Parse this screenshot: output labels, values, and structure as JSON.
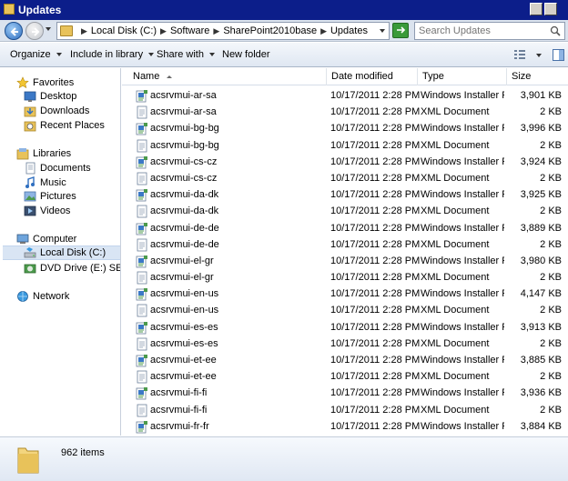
{
  "window": {
    "title": "Updates"
  },
  "address": {
    "crumbs": [
      "Local Disk (C:)",
      "Software",
      "SharePoint2010base",
      "Updates"
    ],
    "search_placeholder": "Search Updates"
  },
  "toolbar": {
    "organize": "Organize",
    "include": "Include in library",
    "share": "Share with",
    "new_folder": "New folder"
  },
  "nav": {
    "favorites": "Favorites",
    "desktop": "Desktop",
    "downloads": "Downloads",
    "recent": "Recent Places",
    "libraries": "Libraries",
    "documents": "Documents",
    "music": "Music",
    "pictures": "Pictures",
    "videos": "Videos",
    "computer": "Computer",
    "local_disk": "Local Disk (C:)",
    "dvd": "DVD Drive (E:) SERVEF",
    "network": "Network"
  },
  "columns": {
    "name": "Name",
    "date": "Date modified",
    "type": "Type",
    "size": "Size"
  },
  "files": [
    {
      "name": "acsrvmui-ar-sa",
      "date": "10/17/2011 2:28 PM",
      "type": "Windows Installer P...",
      "size": "3,901 KB",
      "icon": "msi-installer-icon"
    },
    {
      "name": "acsrvmui-ar-sa",
      "date": "10/17/2011 2:28 PM",
      "type": "XML Document",
      "size": "2 KB",
      "icon": "xml-document-icon"
    },
    {
      "name": "acsrvmui-bg-bg",
      "date": "10/17/2011 2:28 PM",
      "type": "Windows Installer P...",
      "size": "3,996 KB",
      "icon": "msi-installer-icon"
    },
    {
      "name": "acsrvmui-bg-bg",
      "date": "10/17/2011 2:28 PM",
      "type": "XML Document",
      "size": "2 KB",
      "icon": "xml-document-icon"
    },
    {
      "name": "acsrvmui-cs-cz",
      "date": "10/17/2011 2:28 PM",
      "type": "Windows Installer P...",
      "size": "3,924 KB",
      "icon": "msi-installer-icon"
    },
    {
      "name": "acsrvmui-cs-cz",
      "date": "10/17/2011 2:28 PM",
      "type": "XML Document",
      "size": "2 KB",
      "icon": "xml-document-icon"
    },
    {
      "name": "acsrvmui-da-dk",
      "date": "10/17/2011 2:28 PM",
      "type": "Windows Installer P...",
      "size": "3,925 KB",
      "icon": "msi-installer-icon"
    },
    {
      "name": "acsrvmui-da-dk",
      "date": "10/17/2011 2:28 PM",
      "type": "XML Document",
      "size": "2 KB",
      "icon": "xml-document-icon"
    },
    {
      "name": "acsrvmui-de-de",
      "date": "10/17/2011 2:28 PM",
      "type": "Windows Installer P...",
      "size": "3,889 KB",
      "icon": "msi-installer-icon"
    },
    {
      "name": "acsrvmui-de-de",
      "date": "10/17/2011 2:28 PM",
      "type": "XML Document",
      "size": "2 KB",
      "icon": "xml-document-icon"
    },
    {
      "name": "acsrvmui-el-gr",
      "date": "10/17/2011 2:28 PM",
      "type": "Windows Installer P...",
      "size": "3,980 KB",
      "icon": "msi-installer-icon"
    },
    {
      "name": "acsrvmui-el-gr",
      "date": "10/17/2011 2:28 PM",
      "type": "XML Document",
      "size": "2 KB",
      "icon": "xml-document-icon"
    },
    {
      "name": "acsrvmui-en-us",
      "date": "10/17/2011 2:28 PM",
      "type": "Windows Installer P...",
      "size": "4,147 KB",
      "icon": "msi-installer-icon"
    },
    {
      "name": "acsrvmui-en-us",
      "date": "10/17/2011 2:28 PM",
      "type": "XML Document",
      "size": "2 KB",
      "icon": "xml-document-icon"
    },
    {
      "name": "acsrvmui-es-es",
      "date": "10/17/2011 2:28 PM",
      "type": "Windows Installer P...",
      "size": "3,913 KB",
      "icon": "msi-installer-icon"
    },
    {
      "name": "acsrvmui-es-es",
      "date": "10/17/2011 2:28 PM",
      "type": "XML Document",
      "size": "2 KB",
      "icon": "xml-document-icon"
    },
    {
      "name": "acsrvmui-et-ee",
      "date": "10/17/2011 2:28 PM",
      "type": "Windows Installer P...",
      "size": "3,885 KB",
      "icon": "msi-installer-icon"
    },
    {
      "name": "acsrvmui-et-ee",
      "date": "10/17/2011 2:28 PM",
      "type": "XML Document",
      "size": "2 KB",
      "icon": "xml-document-icon"
    },
    {
      "name": "acsrvmui-fi-fi",
      "date": "10/17/2011 2:28 PM",
      "type": "Windows Installer P...",
      "size": "3,936 KB",
      "icon": "msi-installer-icon"
    },
    {
      "name": "acsrvmui-fi-fi",
      "date": "10/17/2011 2:28 PM",
      "type": "XML Document",
      "size": "2 KB",
      "icon": "xml-document-icon"
    },
    {
      "name": "acsrvmui-fr-fr",
      "date": "10/17/2011 2:28 PM",
      "type": "Windows Installer P...",
      "size": "3,884 KB",
      "icon": "msi-installer-icon"
    }
  ],
  "status": {
    "item_count": "962 items"
  }
}
